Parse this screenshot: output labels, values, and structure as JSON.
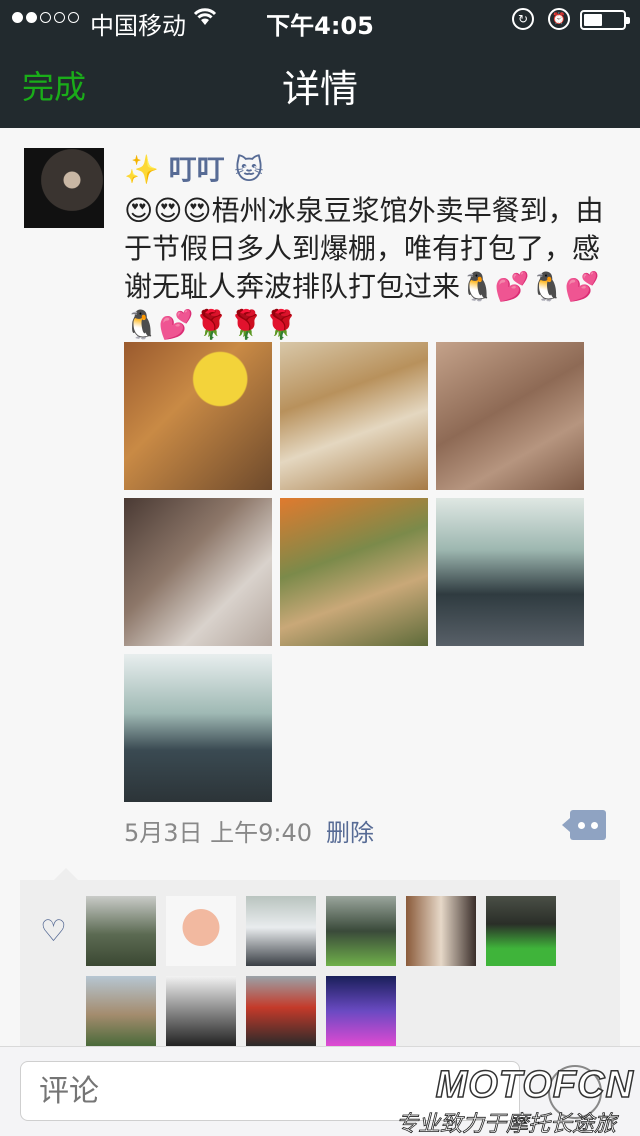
{
  "status_bar": {
    "carrier": "中国移动",
    "time": "下午4:05",
    "signal_dots_filled": 2,
    "signal_dots_total": 5
  },
  "nav": {
    "back_label": "完成",
    "title": "详情"
  },
  "post": {
    "author": "✨ 叮叮 🐱",
    "text": "😍😍😍梧州冰泉豆浆馆外卖早餐到，由于节假日多人到爆棚，唯有打包了，感谢无耻人奔波排队打包过来🐧💕🐧💕🐧💕🌹🌹🌹",
    "date": "5月3日 上午9:40",
    "delete_label": "删除",
    "photo_count": 7
  },
  "comment": {
    "placeholder": "评论"
  },
  "watermark": {
    "brand": "MOTOFCN",
    "tagline": "专业致力于摩托长途旅行"
  },
  "colors": {
    "accent_green": "#1aad19",
    "link_blue": "#576b95",
    "nav_bg": "#222a2e"
  }
}
